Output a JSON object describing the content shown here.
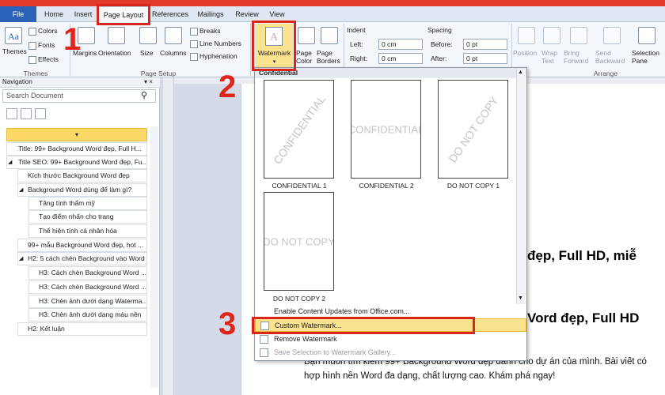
{
  "tabs": {
    "file": "File",
    "home": "Home",
    "insert": "Insert",
    "page_layout": "Page Layout",
    "references": "References",
    "mailings": "Mailings",
    "review": "Review",
    "view": "View"
  },
  "ribbon": {
    "themes": {
      "themes_label": "Themes",
      "colors_label": "Colors",
      "fonts_label": "Fonts",
      "effects_label": "Effects",
      "group_label": "Themes"
    },
    "page_setup": {
      "margins_label": "Margins",
      "orientation_label": "Orientation",
      "size_label": "Size",
      "columns_label": "Columns",
      "breaks_label": "Breaks",
      "line_numbers_label": "Line Numbers",
      "hyphenation_label": "Hyphenation",
      "group_label": "Page Setup"
    },
    "page_background": {
      "watermark_label": "Watermark",
      "page_color_label": "Page Color",
      "page_borders_label": "Page Borders"
    },
    "paragraph": {
      "indent_label": "Indent",
      "left_label": "Left:",
      "left_value": "0 cm",
      "right_label": "Right:",
      "right_value": "0 cm",
      "spacing_label": "Spacing",
      "before_label": "Before:",
      "before_value": "0 pt",
      "after_label": "After:",
      "after_value": "0 pt"
    },
    "arrange": {
      "position_label": "Position",
      "wrap_text_label": "Wrap Text",
      "bring_forward_label": "Bring Forward",
      "send_backward_label": "Send Backward",
      "selection_pane_label": "Selection Pane",
      "group_label": "Arrange"
    }
  },
  "steps": {
    "step1": "1",
    "step2": "2",
    "step3": "3"
  },
  "navigation": {
    "title": "Navigation",
    "search_placeholder": "Search Document",
    "items": [
      "Title: 99+ Background Word đẹp, Full H...",
      "Title SEO: 99+ Background Word đẹp, Fu...",
      "Kích thước Background Word đẹp",
      "Background Word dùng để làm gì?",
      "Tăng tính thẩm mỹ",
      "Tạo điểm nhấn cho trang",
      "Thể hiện tính cá nhân hóa",
      "99+ mẫu Background Word đẹp, hot ...",
      "H2: 5 cách chèn Background vào Word",
      "H3: Cách chèn Background Word ...",
      "H3: Cách chèn Background Word ...",
      "H3: Chèn ảnh dưới dạng Waterma...",
      "H3: Chèn ảnh dưới dạng màu nền",
      "H2: Kết luận"
    ]
  },
  "watermark_gallery": {
    "section_title": "Confidential",
    "thumbs": [
      {
        "text": "CONFIDENTIAL",
        "caption": "CONFIDENTIAL 1"
      },
      {
        "text": "CONFIDENTIAL",
        "caption": "CONFIDENTIAL 2"
      },
      {
        "text": "DO NOT COPY",
        "caption": "DO NOT COPY 1"
      },
      {
        "text": "DO NOT COPY",
        "caption": "DO NOT COPY 2"
      }
    ],
    "menu": {
      "enable_updates": "Enable Content Updates from Office.com...",
      "custom": "Custom Watermark...",
      "remove": "Remove Watermark",
      "save_selection": "Save Selection to Watermark Gallery..."
    }
  },
  "document": {
    "heading1": "đẹp, Full HD, miễ",
    "heading2": "Vord đẹp, Full HD",
    "body_line1": "Bạn muốn tìm kiếm 99+ Background Word đẹp dành cho dự án của mình. Bài viết có",
    "body_line2": "hợp hình nền Word đa dạng, chất lượng cao. Khám phá ngay!"
  },
  "colors": {
    "accent_red": "#d9261c",
    "file_tab_blue": "#2a63b8",
    "highlight_yellow": "#fbe28e"
  }
}
